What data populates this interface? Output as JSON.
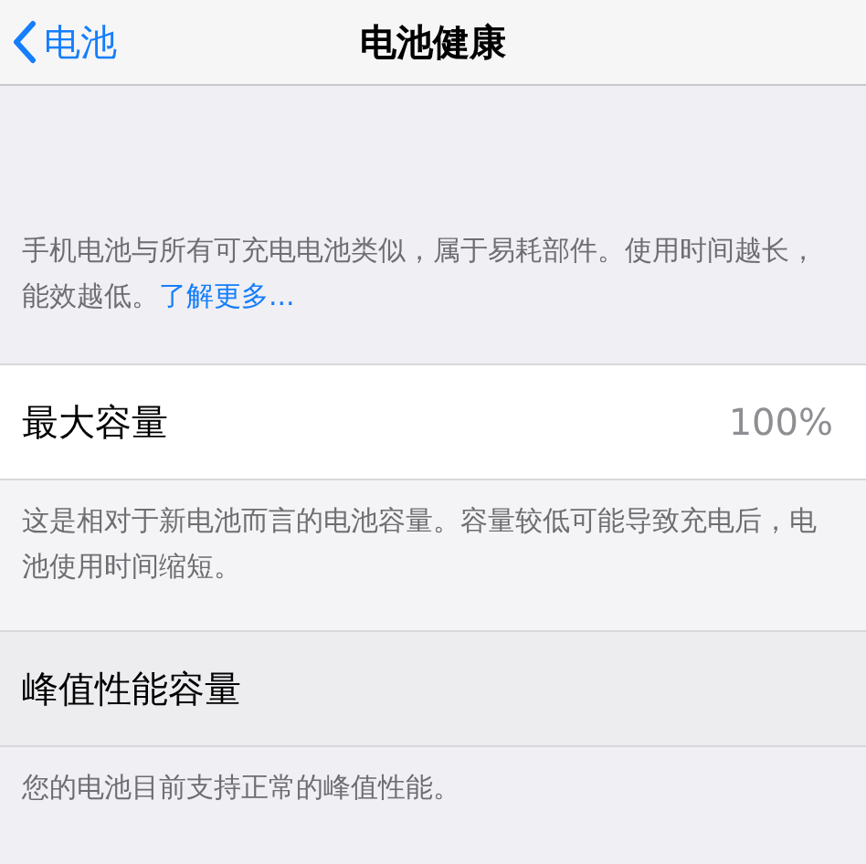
{
  "nav": {
    "back_label": "电池",
    "title": "电池健康"
  },
  "intro": {
    "text": "手机电池与所有可充电电池类似，属于易耗部件。使用时间越长，能效越低。",
    "link": "了解更多..."
  },
  "sections": [
    {
      "title": "最大容量",
      "value": "100%",
      "footer": "这是相对于新电池而言的电池容量。容量较低可能导致充电后，电池使用时间缩短。"
    },
    {
      "title": "峰值性能容量",
      "footer": "您的电池目前支持正常的峰值性能。"
    }
  ]
}
